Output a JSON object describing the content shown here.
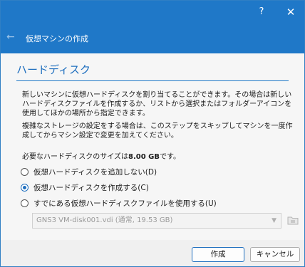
{
  "titlebar": {
    "help": "?",
    "close": "✕",
    "back": "←",
    "title": "仮想マシンの作成"
  },
  "page": {
    "heading": "ハードディスク",
    "para1": "新しいマシンに仮想ハードディスクを割り当てることができます。その場合は新しいハードディスクファイルを作成するか、リストから選択またはフォルダーアイコンを使用してほかの場所から指定できます。",
    "para2": "複雑なストレージの設定をする場合は、このステップをスキップしてマシンを一度作成してからマシン設定で変更を加えてください。",
    "size_prefix": "必要なハードディスクのサイズは",
    "size_value": "8.00 GB",
    "size_suffix": "です。"
  },
  "options": [
    {
      "label": "仮想ハードディスクを追加しない(D)",
      "selected": false
    },
    {
      "label": "仮想ハードディスクを作成する(C)",
      "selected": true
    },
    {
      "label": "すでにある仮想ハードディスクファイルを使用する(U)",
      "selected": false
    }
  ],
  "disk_select": {
    "value": "GNS3 VM-disk001.vdi (通常, 19.53 GB)",
    "arrow": "▼"
  },
  "footer": {
    "create": "作成",
    "cancel": "キャンセル"
  }
}
